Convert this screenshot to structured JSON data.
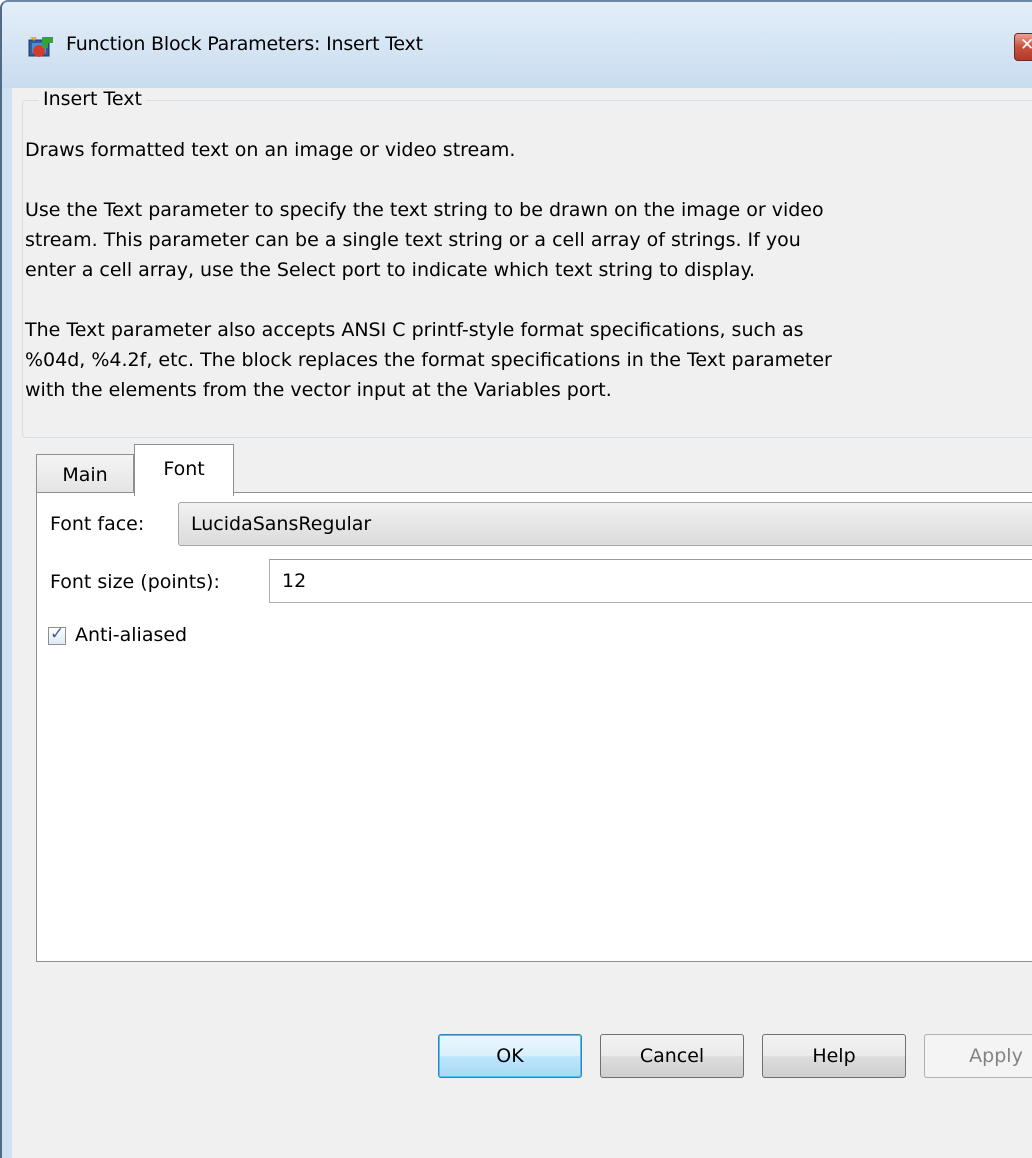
{
  "window": {
    "title": "Function Block Parameters: Insert Text",
    "icon": "simulink-block-icon",
    "close_icon": "close-icon"
  },
  "group": {
    "title": "Insert Text",
    "lines": [
      "Draws formatted text on an image or video stream.",
      "Use the Text parameter to specify the text string to be drawn on the image or video",
      "stream. This parameter can be a single text string or a cell array of strings. If you",
      "enter a cell array, use the Select port to indicate which text string to display.",
      "The Text parameter also accepts ANSI C printf-style format specifications, such as",
      "%04d, %4.2f, etc. The block replaces the format specifications in the Text parameter",
      "with the elements from the vector input at the Variables port."
    ]
  },
  "tabs": [
    {
      "label": "Main",
      "selected": false
    },
    {
      "label": "Font",
      "selected": true
    }
  ],
  "font_tab": {
    "font_face_label": "Font face:",
    "font_face_value": "LucidaSansRegular",
    "font_size_label": "Font size (points):",
    "font_size_value": "12",
    "anti_aliased_label": "Anti-aliased",
    "anti_aliased_checked": true
  },
  "buttons": {
    "ok": "OK",
    "cancel": "Cancel",
    "help": "Help",
    "apply": "Apply"
  }
}
